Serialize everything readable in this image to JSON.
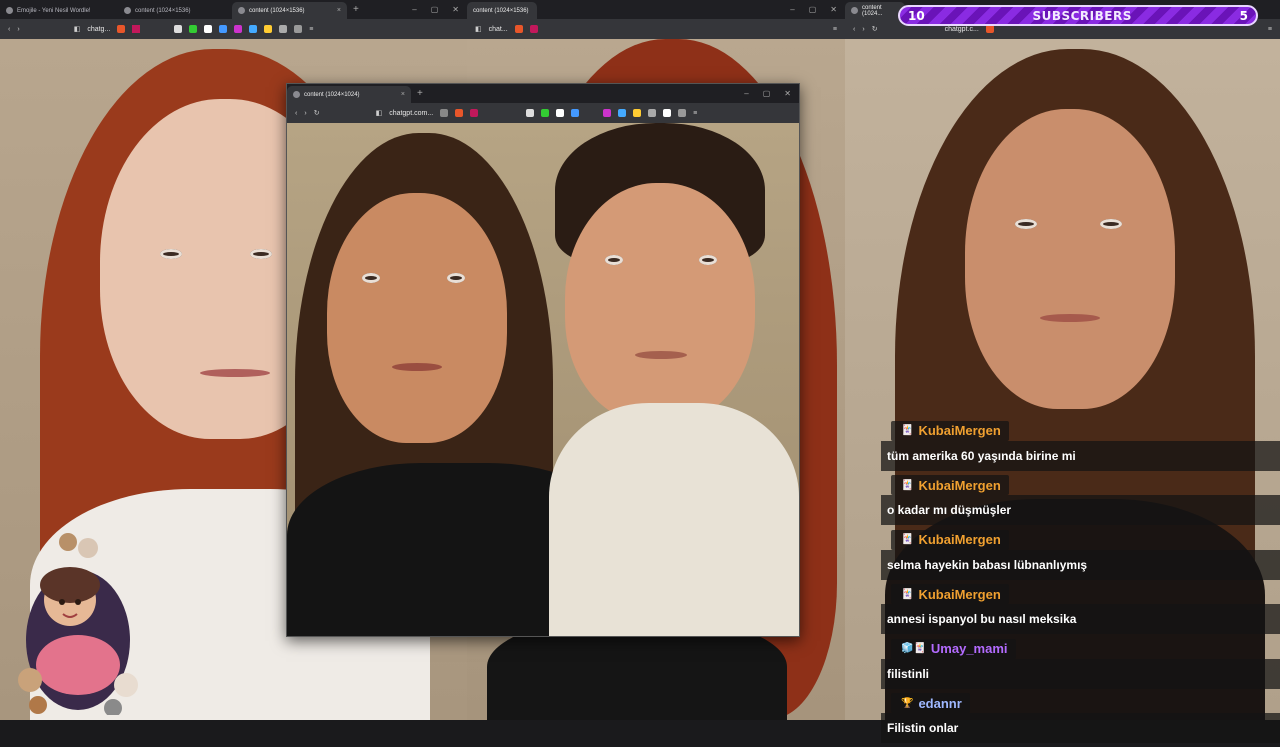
{
  "left_window": {
    "tabs": [
      {
        "label": "Emojile - Yeni Nesil Wordle!"
      },
      {
        "label": "content (1024×1536)"
      },
      {
        "label": "content (1024×1536)"
      }
    ],
    "new_tab": "+",
    "address": "chatg..."
  },
  "middle_window": {
    "tab_label": "content (1024×1536)",
    "address": "chat..."
  },
  "right_window": {
    "tab_label": "content (1024...",
    "address": "chatgpt.c..."
  },
  "popup_window": {
    "tab_label": "content (1024×1024)",
    "address": "chatgpt.com...",
    "new_tab": "+"
  },
  "subscribers": {
    "current": "10",
    "title": "SUBSCRIBERS",
    "goal": "5"
  },
  "chat": {
    "messages": [
      {
        "user": "KubaiMergen",
        "color": "#f0a030",
        "badge": "🃏",
        "text": "tüm amerika 60 yaşında birine mi"
      },
      {
        "user": "KubaiMergen",
        "color": "#f0a030",
        "badge": "🃏",
        "text": "o kadar mı düşmüşler"
      },
      {
        "user": "KubaiMergen",
        "color": "#f0a030",
        "badge": "🃏",
        "text": "selma hayekin babası lübnanlıymış"
      },
      {
        "user": "KubaiMergen",
        "color": "#f0a030",
        "badge": "🃏",
        "text": "annesi ispanyol bu nasıl meksika"
      },
      {
        "user": "Umay_mami",
        "color": "#b36bff",
        "badge": "🧊🃏",
        "text": "filistinli"
      },
      {
        "user": "edannr",
        "color": "#9fb8ff",
        "badge": "🏆",
        "text": "Filistin onlar"
      }
    ]
  },
  "colors": {
    "accent_purple": "#8a2be2",
    "chat_bg": "#141414",
    "browser_chrome": "#35363a"
  }
}
